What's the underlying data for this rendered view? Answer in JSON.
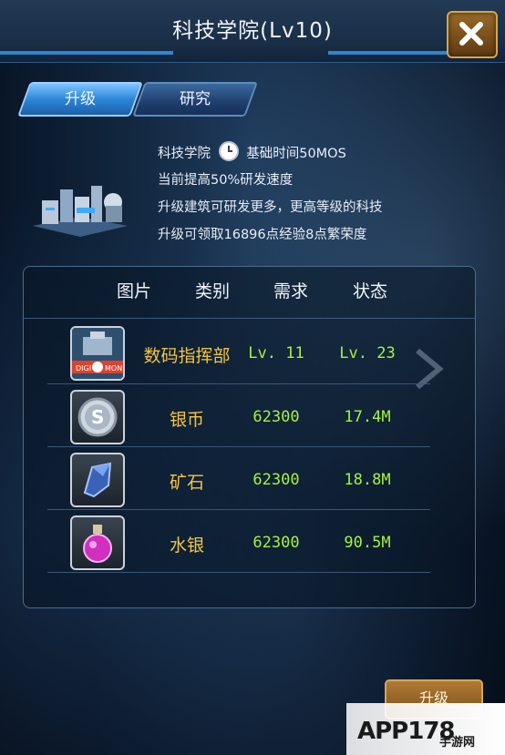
{
  "title": "科技学院(Lv10)",
  "tabs": [
    {
      "label": "升级",
      "active": true
    },
    {
      "label": "研究",
      "active": false
    }
  ],
  "info": {
    "line1_building": "科技学院",
    "line1_time": "基础时间50MOS",
    "line2": "当前提高50%研发速度",
    "line3": "升级建筑可研发更多，更高等级的科技",
    "line4": "升级可领取16896点经验8点繁荣度"
  },
  "table": {
    "headers": [
      "图片",
      "类别",
      "需求",
      "状态"
    ],
    "rows": [
      {
        "icon": "digimon-command-icon",
        "name": "数码指挥部",
        "need": "Lv. 11",
        "status": "Lv. 23"
      },
      {
        "icon": "silver-coin-icon",
        "name": "银币",
        "need": "62300",
        "status": "17.4M"
      },
      {
        "icon": "ore-crystal-icon",
        "name": "矿石",
        "need": "62300",
        "status": "18.8M"
      },
      {
        "icon": "mercury-potion-icon",
        "name": "水银",
        "need": "62300",
        "status": "90.5M"
      }
    ]
  },
  "upgrade_button": "升级",
  "watermark": {
    "main": "APP178",
    "sub": "手游网"
  },
  "colors": {
    "name_gold": "#f5c542",
    "value_green": "#a6f23f"
  }
}
